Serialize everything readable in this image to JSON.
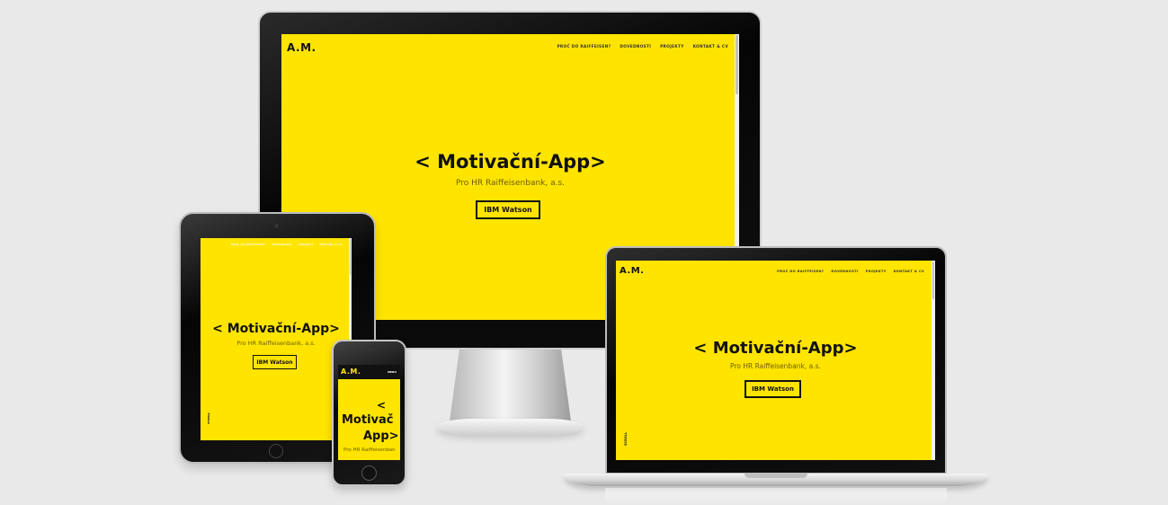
{
  "site": {
    "logo": "A.M.",
    "nav": [
      "PROČ DO RAIFFEISEN?",
      "DOVEDNOSTI",
      "PROJEKTY",
      "KONTAKT & CV"
    ],
    "hero_title": "< Motivační-App>",
    "hero_subtitle": "Pro HR Raiffeisenbank, a.s.",
    "hero_button": "IBM Watson",
    "scroll_hint": "SCROLL",
    "phone_menu": "MENU",
    "phone_title_lines": [
      "<",
      "Motivač",
      "App>"
    ],
    "phone_subtitle": "Pro HR Raiffeisenban"
  },
  "colors": {
    "accent": "#ffe400",
    "text": "#111111",
    "background": "#e9e9e9"
  }
}
